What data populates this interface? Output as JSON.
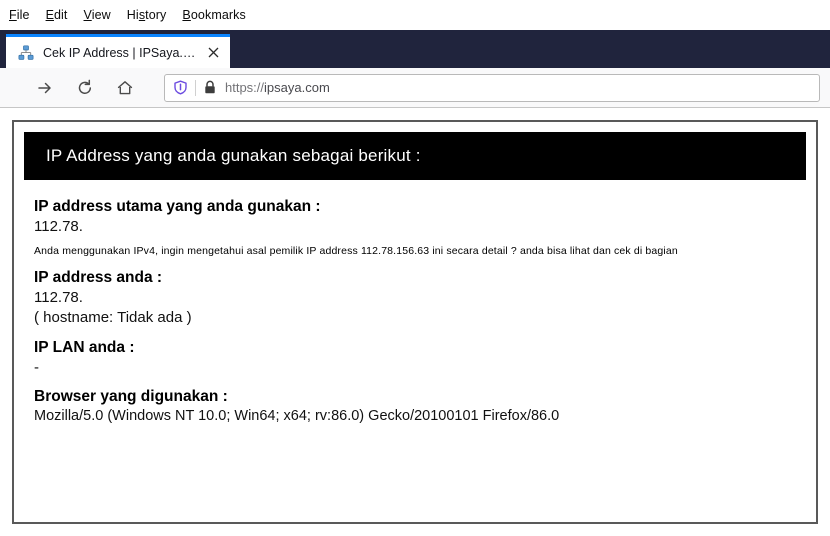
{
  "menubar": {
    "items": [
      {
        "label": "File",
        "accel": "F"
      },
      {
        "label": "Edit",
        "accel": "E"
      },
      {
        "label": "View",
        "accel": "V"
      },
      {
        "label": "History",
        "accel": "s"
      },
      {
        "label": "Bookmarks",
        "accel": "B"
      }
    ]
  },
  "tab": {
    "title": "Cek IP Address | IPSaya.com",
    "favicon": "network-sitemap-icon",
    "close_label": "✕"
  },
  "toolbar": {
    "forward_icon": "arrow-right-icon",
    "reload_icon": "reload-icon",
    "home_icon": "home-icon"
  },
  "urlbar": {
    "shield_icon": "shield-icon",
    "lock_icon": "padlock-icon",
    "url_scheme": "https://",
    "url_host": "ipsaya.com",
    "url_full": "https://ipsaya.com"
  },
  "page": {
    "header": "IP Address yang anda gunakan sebagai berikut :",
    "label_main_ip": "IP address utama yang anda gunakan :",
    "value_main_ip": "112.78.",
    "note": "Anda menggunakan IPv4, ingin mengetahui asal pemilik IP address 112.78.156.63 ini secara detail ? anda bisa lihat dan cek di bagian",
    "label_your_ip": "IP address anda :",
    "value_your_ip": "112.78.",
    "hostname_line": "( hostname: Tidak ada )",
    "label_lan_ip": "IP LAN anda :",
    "value_lan_ip": "-",
    "label_browser": "Browser yang digunakan :",
    "value_browser": "Mozilla/5.0 (Windows NT 10.0; Win64; x64; rv:86.0) Gecko/20100101 Firefox/86.0"
  },
  "colors": {
    "chrome_navy": "#20243D",
    "tab_accent": "#0A84FF",
    "header_bg": "#000000",
    "page_border": "#595959",
    "shield_purple": "#6C4CE0"
  }
}
